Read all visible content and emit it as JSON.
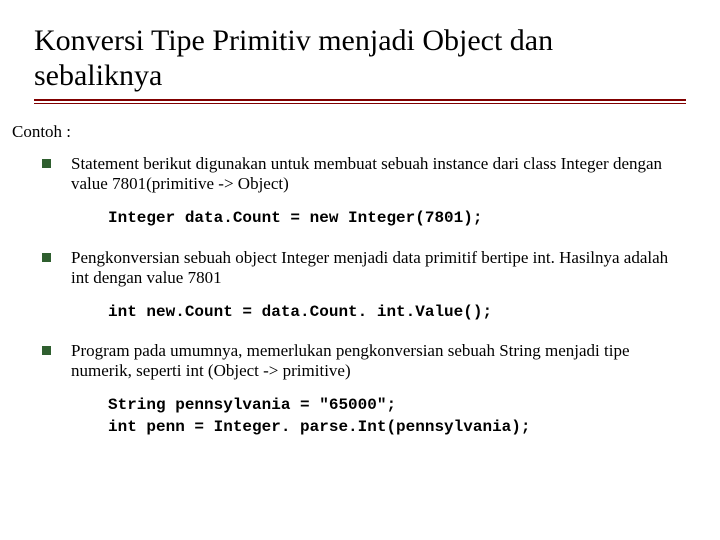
{
  "title": "Konversi Tipe Primitiv menjadi Object dan sebaliknya",
  "subhead": "Contoh :",
  "items": [
    {
      "text": "Statement berikut digunakan untuk membuat sebuah instance dari class Integer dengan value 7801(primitive -> Object)",
      "code": "Integer data.Count = new Integer(7801);"
    },
    {
      "text": "Pengkonversian sebuah object Integer menjadi data primitif bertipe int. Hasilnya adalah int dengan value 7801",
      "code": "int new.Count = data.Count. int.Value();"
    },
    {
      "text": "Program pada umumnya, memerlukan pengkonversian sebuah String menjadi tipe numerik, seperti int (Object -> primitive)",
      "code": "String pennsylvania = \"65000\";\nint penn = Integer. parse.Int(pennsylvania);"
    }
  ]
}
